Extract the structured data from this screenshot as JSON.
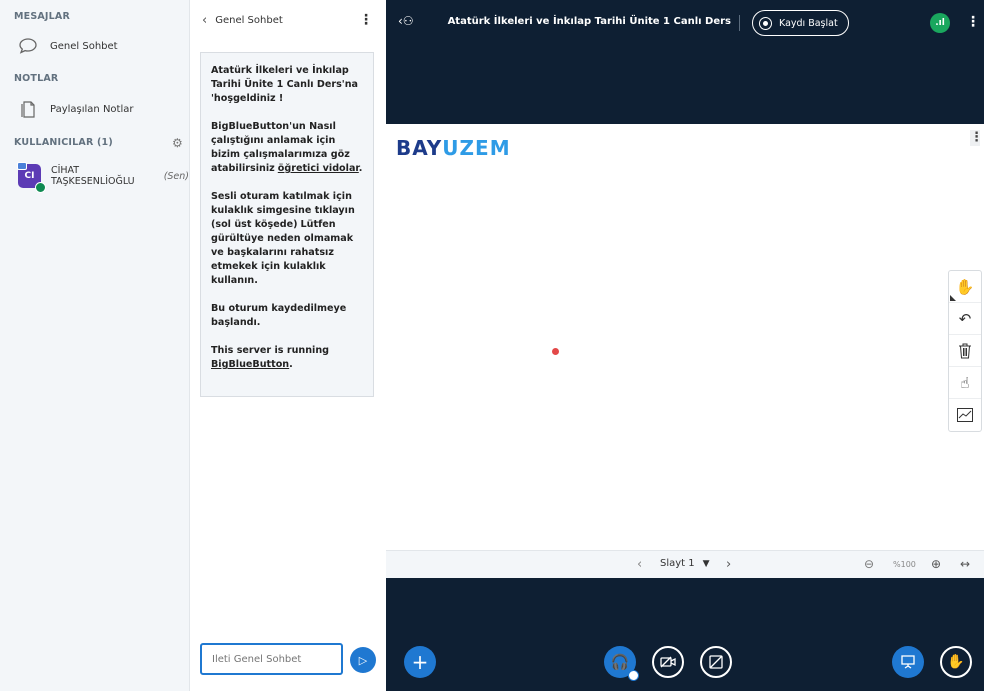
{
  "userlist": {
    "messages_title": "MESAJLAR",
    "public_chat_label": "Genel Sohbet",
    "notes_title": "NOTLAR",
    "shared_notes_label": "Paylaşılan Notlar",
    "users_title": "KULLANICILAR (1)",
    "users": [
      {
        "initials": "CI",
        "name": "CİHAT TAŞKESENLİOĞLU",
        "you_label": "(Sen)"
      }
    ]
  },
  "chat": {
    "header_title": "Genel Sohbet",
    "welcome": {
      "line1": "Atatürk İlkeleri ve İnkılap Tarihi Ünite 1 Canlı Ders'na 'hoşgeldiniz !",
      "line2_prefix": "BigBlueButton'un Nasıl çalıştığını anlamak için bizim çalışmalarımıza göz atabilirsiniz",
      "line2_link": "öğretici vidolar",
      "line2_suffix": ".",
      "line3_a": "Sesli oturam katılmak için kulaklık simgesine tıklayın (sol üst köşede)",
      "line3_b": "Lütfen gürültüye neden olmamak ve başkalarını rahatsız etmekek için kulaklık kullanın.",
      "line4": "Bu oturum kaydedilmeye başlandı.",
      "line5_prefix": "This server is running",
      "line5_link": "BigBlueButton",
      "line5_suffix": "."
    },
    "input_placeholder": "İleti Genel Sohbet"
  },
  "topbar": {
    "meeting_title": "Atatürk İlkeleri ve İnkılap Tarihi Ünite 1 Canlı Ders",
    "record_label": "Kaydı Başlat",
    "signal_glyph": ".ıl"
  },
  "presentation": {
    "logo_part1": "BAY",
    "logo_part2": "UZEM",
    "slide_label": "Slayt 1",
    "zoom_label": "%100"
  },
  "icons": {
    "chat": "chat-bubble-icon",
    "notes": "document-icon",
    "settings": "gear-icon",
    "hand": "hand-icon",
    "undo": "undo-icon",
    "trash": "trash-icon",
    "multi_user": "multi-user-icon",
    "chart": "line-chart-icon"
  },
  "colors": {
    "accent": "#1f78d1",
    "dark_bg": "#0e1f33",
    "avatar": "#5c3bb5",
    "signal": "#1aa75e"
  }
}
